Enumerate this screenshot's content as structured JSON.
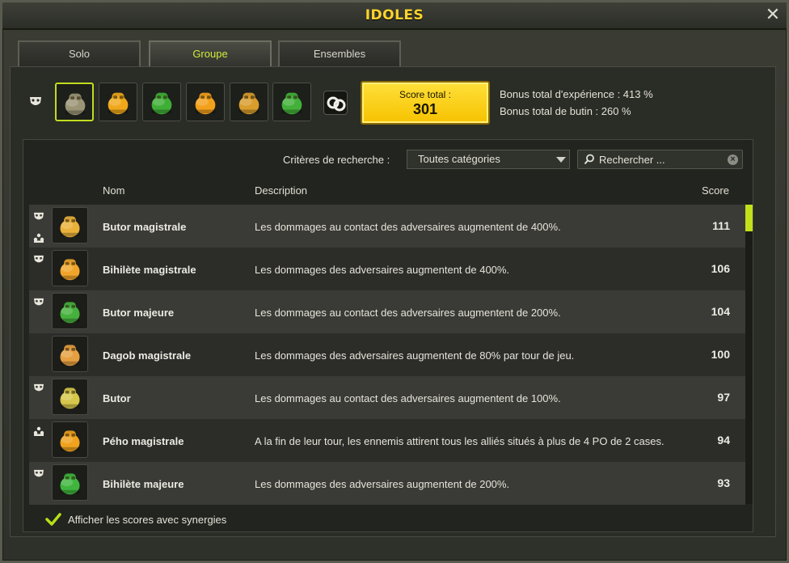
{
  "window": {
    "title": "IDOLES",
    "close_label": "✕"
  },
  "tabs": [
    {
      "label": "Solo",
      "active": false
    },
    {
      "label": "Groupe",
      "active": true
    },
    {
      "label": "Ensembles",
      "active": false
    }
  ],
  "idol_slots": [
    {
      "icon": "stone-idol-icon",
      "color": "#9b9576",
      "selected": true
    },
    {
      "icon": "gold-idol-icon",
      "color": "#f0a81a",
      "selected": false
    },
    {
      "icon": "green-idol-icon",
      "color": "#3fae36",
      "selected": false
    },
    {
      "icon": "orange-round-idol-icon",
      "color": "#f3a01b",
      "selected": false
    },
    {
      "icon": "gold-figure-idol-icon",
      "color": "#d99d2c",
      "selected": false
    },
    {
      "icon": "green-robot-idol-icon",
      "color": "#43b03a",
      "selected": false
    }
  ],
  "score": {
    "label": "Score total :",
    "value": "301"
  },
  "bonuses": {
    "experience": "Bonus total d'expérience : 413 %",
    "loot": "Bonus total de butin : 260 %"
  },
  "filters": {
    "criteria_label": "Critères de recherche :",
    "category_selected": "Toutes catégories",
    "search_placeholder": "Rechercher ..."
  },
  "table": {
    "headers": {
      "name": "Nom",
      "description": "Description",
      "score": "Score"
    },
    "rows": [
      {
        "icon_top": "mask-icon",
        "icon_bottom": "group-icon",
        "thumb_color": "#e9b13a",
        "name": "Butor magistrale",
        "description": "Les dommages au contact des adversaires augmentent de 400%.",
        "score": "111"
      },
      {
        "icon_top": "mask-icon",
        "icon_bottom": "",
        "thumb_color": "#f0a52a",
        "name": "Bihilète magistrale",
        "description": "Les dommages des adversaires augmentent de 400%.",
        "score": "106"
      },
      {
        "icon_top": "mask-icon",
        "icon_bottom": "",
        "thumb_color": "#46b13c",
        "name": "Butor majeure",
        "description": "Les dommages au contact des adversaires augmentent de 200%.",
        "score": "104"
      },
      {
        "icon_top": "",
        "icon_bottom": "",
        "thumb_color": "#e7a040",
        "name": "Dagob magistrale",
        "description": "Les dommages des adversaires augmentent de 80% par tour de jeu.",
        "score": "100"
      },
      {
        "icon_top": "mask-icon",
        "icon_bottom": "",
        "thumb_color": "#d6c64a",
        "name": "Butor",
        "description": "Les dommages au contact des adversaires augmentent de 100%.",
        "score": "97"
      },
      {
        "icon_top": "group-icon",
        "icon_bottom": "",
        "thumb_color": "#f0a21e",
        "name": "Pého magistrale",
        "description": "A la fin de leur tour, les ennemis attirent tous les alliés situés à plus de 4 PO de 2 cases.",
        "score": "94"
      },
      {
        "icon_top": "mask-icon",
        "icon_bottom": "",
        "thumb_color": "#3fb53d",
        "name": "Bihilète majeure",
        "description": "Les dommages des adversaires augmentent de 200%.",
        "score": "93"
      }
    ]
  },
  "footer": {
    "checkbox_checked": true,
    "label": "Afficher les scores avec synergies"
  },
  "colors": {
    "accent": "#c3e11a",
    "title": "#ffd42a",
    "score_box": "#f6c200"
  }
}
